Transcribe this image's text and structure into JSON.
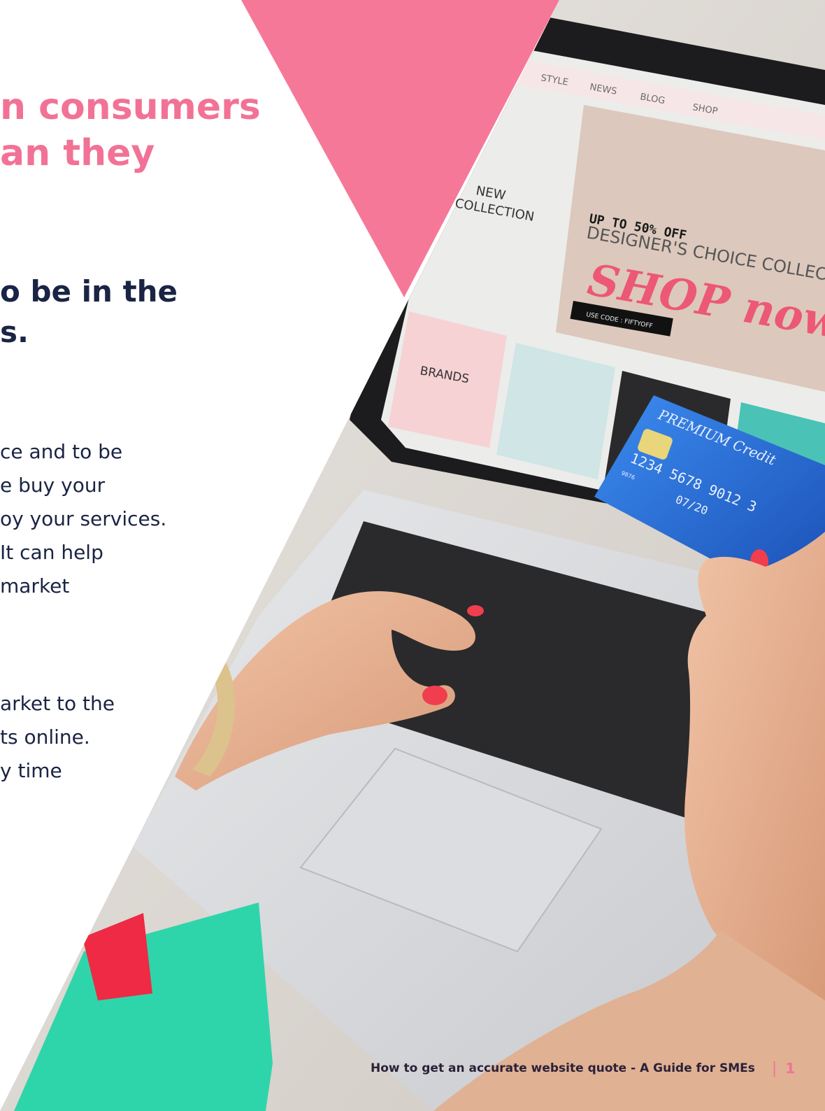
{
  "headline": {
    "line1": "n consumers",
    "line2": "an they"
  },
  "subhead": {
    "line1": "o be in the",
    "line2": "s."
  },
  "paragraph1": [
    "ce and to be",
    "e buy your",
    "oy your services.",
    " It can help",
    " market"
  ],
  "paragraph2": [
    "arket to the",
    "ts online.",
    "y time"
  ],
  "photo": {
    "nav_items": [
      "STYLE",
      "NEWS",
      "BLOG",
      "SHOP"
    ],
    "new_collection_line1": "NEW",
    "new_collection_line2": "COLLECTION",
    "promo": "UP TO 50% OFF",
    "designers": "DESIGNER'S CHOICE COLLEC",
    "shop_now": "SHOP now",
    "use_code": "USE CODE : FIFTYOFF",
    "brands": "BRANDS",
    "card_brand": "PREMIUM Credit",
    "card_number": "1234 5678 9012 3",
    "card_small": "9876",
    "card_valid": "07/20"
  },
  "footer": {
    "title": "How to get an accurate website quote - A Guide for SMEs",
    "separator": "|",
    "page_number": "1"
  },
  "colors": {
    "pink": "#f27296",
    "navy": "#1a2444",
    "teal": "#2fd5aa",
    "card_blue": "#2f74d8"
  }
}
